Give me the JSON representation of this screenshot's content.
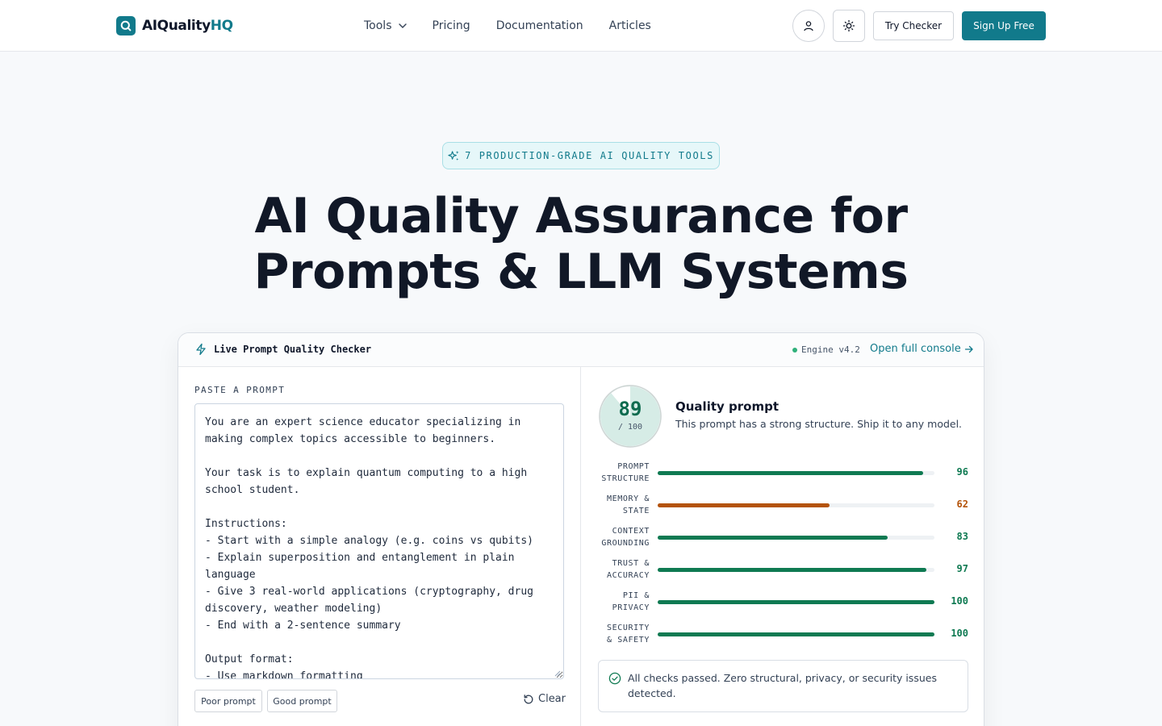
{
  "header": {
    "logo_text": "AIQuality",
    "logo_accent": "HQ",
    "nav": [
      {
        "label": "Tools"
      },
      {
        "label": "Pricing"
      },
      {
        "label": "Documentation"
      },
      {
        "label": "Articles"
      }
    ],
    "try_label": "Try Checker",
    "signup_label": "Sign Up Free"
  },
  "hero": {
    "pill": "7 PRODUCTION-GRADE AI QUALITY TOOLS",
    "title_line1": "AI Quality Assurance for",
    "title_line2": "Prompts & LLM Systems"
  },
  "checker": {
    "title": "Live Prompt Quality Checker",
    "engine": "Engine v4.2",
    "console_link": "Open full console",
    "input_label": "PASTE A PROMPT",
    "prompt_text": "You are an expert science educator specializing in\nmaking complex topics accessible to beginners.\n\nYour task is to explain quantum computing to a high\nschool student.\n\nInstructions:\n- Start with a simple analogy (e.g. coins vs qubits)\n- Explain superposition and entanglement in plain\nlanguage\n- Give 3 real-world applications (cryptography, drug\ndiscovery, weather modeling)\n- End with a 2-sentence summary\n\nOutput format:\n- Use markdown formatting",
    "poor_label": "Poor prompt",
    "good_label": "Good prompt",
    "clear_label": "Clear",
    "score": "89",
    "score_value": 89,
    "score_max": "/ 100",
    "verdict_title": "Quality prompt",
    "verdict_desc": "This prompt has a strong structure. Ship it to any model.",
    "metrics": [
      {
        "line1": "PROMPT",
        "line2": "STRUCTURE",
        "value": 96,
        "value_text": "96",
        "color": "#0f7a52"
      },
      {
        "line1": "MEMORY &",
        "line2": "STATE",
        "value": 62,
        "value_text": "62",
        "color": "#b45309"
      },
      {
        "line1": "CONTEXT",
        "line2": "GROUNDING",
        "value": 83,
        "value_text": "83",
        "color": "#0f7a52"
      },
      {
        "line1": "TRUST &",
        "line2": "ACCURACY",
        "value": 97,
        "value_text": "97",
        "color": "#0f7a52"
      },
      {
        "line1": "PII &",
        "line2": "PRIVACY",
        "value": 100,
        "value_text": "100",
        "color": "#0f7a52"
      },
      {
        "line1": "SECURITY",
        "line2": "& SAFETY",
        "value": 100,
        "value_text": "100",
        "color": "#0f7a52"
      }
    ],
    "checks_text": "All checks passed. Zero structural, privacy, or security issues detected."
  },
  "colors": {
    "brand": "#117a8b",
    "good": "#0f7a52",
    "warn": "#b45309"
  }
}
